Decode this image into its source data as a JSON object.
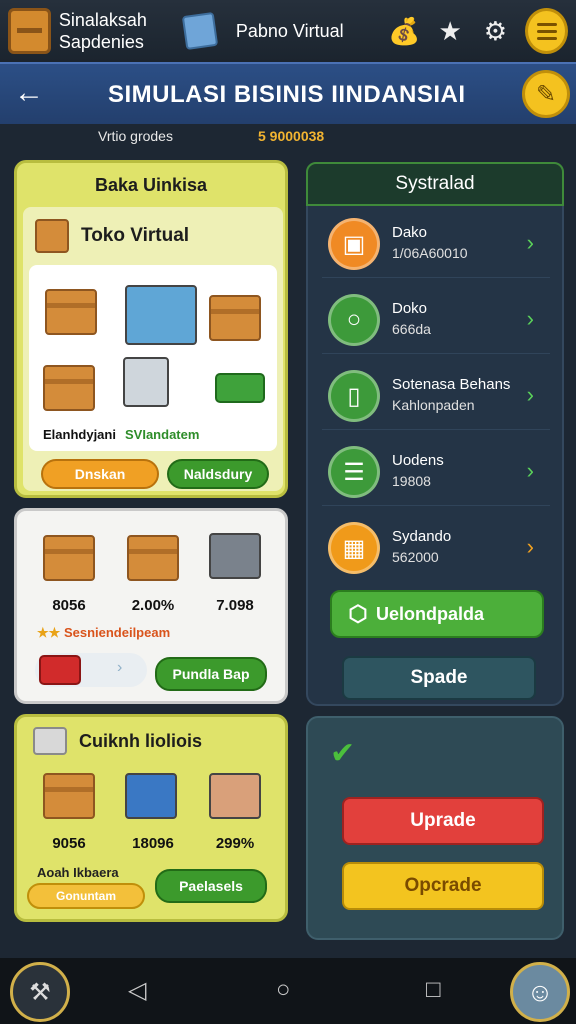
{
  "topbar": {
    "brand_line1": "Sinalaksah",
    "brand_line2": "Sapdenies",
    "title": "Pabno Virtual",
    "icons": [
      "money-bag-icon",
      "star-icon",
      "gear-icon",
      "menu-icon"
    ]
  },
  "header": {
    "title": "SIMULASI BISINIS IINDANSIAI",
    "back_icon": "arrow-left-icon",
    "edit_icon": "pencil-icon"
  },
  "subheader": {
    "left": "Vrtio grodes",
    "right": "5 9000038"
  },
  "left_panel_1": {
    "title": "Baka Uinkisa",
    "card_title": "Toko Virtual",
    "caption_a": "Elanhdyjani",
    "caption_b": "SVIandatem",
    "btn_orange": "Dnskan",
    "btn_green": "Naldsdury"
  },
  "left_panel_2": {
    "values": [
      "8056",
      "2.00%",
      "7.098"
    ],
    "note": "Sesniendeilpeam",
    "btn_green": "Pundla Bap"
  },
  "left_panel_3": {
    "title": "Cuiknh lioliois",
    "values": [
      "9056",
      "18096",
      "299%"
    ],
    "caption": "Aoah Ikbaera",
    "btn_yellow": "Gonuntam",
    "btn_green": "Paelasels"
  },
  "right_panel": {
    "tab_label": "Systralad",
    "items": [
      {
        "l1": "Dako",
        "l2": "1/06A60010",
        "icon": "chart-icon",
        "color": "#f08a24"
      },
      {
        "l1": "Doko",
        "l2": "666da",
        "icon": "cup-icon",
        "color": "#3d9a3a"
      },
      {
        "l1": "Sotenasa Behans",
        "l2": "Kahlonpaden",
        "icon": "phone-icon",
        "color": "#3d9a3a"
      },
      {
        "l1": "Uodens",
        "l2": "19808",
        "icon": "cart-icon",
        "color": "#3d9a3a"
      },
      {
        "l1": "Sydando",
        "l2": "562000",
        "icon": "store-icon",
        "color": "#f09a1a"
      }
    ],
    "big_green": "Uelondpalda",
    "spade": "Spade"
  },
  "action_panel": {
    "red_button": "Uprade",
    "yellow_button": "Opcrade"
  }
}
